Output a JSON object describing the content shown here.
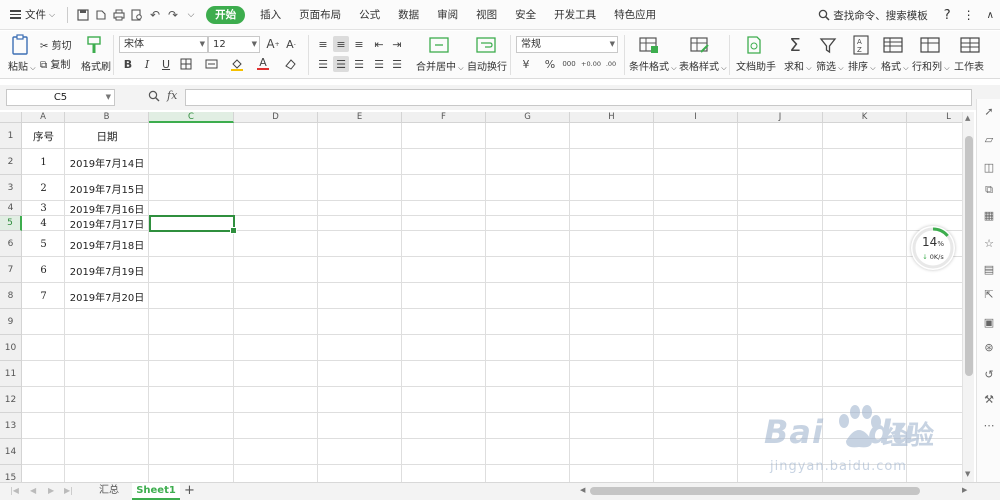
{
  "menubar": {
    "file_label": "文件",
    "tabs": [
      "开始",
      "插入",
      "页面布局",
      "公式",
      "数据",
      "审阅",
      "视图",
      "安全",
      "开发工具",
      "特色应用"
    ],
    "active_tab": "开始",
    "search_label": "查找命令、搜索模板",
    "help": "?",
    "more": "⋮",
    "collapse": "∧"
  },
  "ribbon": {
    "paste": "粘贴",
    "cut": "剪切",
    "copy": "复制",
    "format_painter": "格式刷",
    "font_name": "宋体",
    "font_size": "12",
    "bold": "B",
    "italic": "I",
    "underline": "U",
    "font_color_glyph": "A",
    "merge_center": "合并居中",
    "wrap_text": "自动换行",
    "number_format": "常规",
    "percent": "%",
    "thousands": "000",
    "inc_decimal": "+0.00",
    "dec_decimal": ".00",
    "conditional_format": "条件格式",
    "table_style": "表格样式",
    "doc_helper": "文档助手",
    "sum": "求和",
    "filter": "筛选",
    "sort": "排序",
    "format": "格式",
    "row_col": "行和列",
    "worksheet": "工作表"
  },
  "formula_bar": {
    "cell_ref": "C5",
    "fx": "fx",
    "formula": ""
  },
  "grid": {
    "columns": [
      "A",
      "B",
      "C",
      "D",
      "E",
      "F",
      "G",
      "H",
      "I",
      "J",
      "K",
      "L"
    ],
    "selected_column": "C",
    "selected_row": "5",
    "rows": [
      "1",
      "2",
      "3",
      "4",
      "5",
      "6",
      "7",
      "8",
      "9",
      "10",
      "11",
      "12",
      "13",
      "14",
      "15"
    ],
    "header_a": "序号",
    "header_b": "日期",
    "records": [
      {
        "num": "1",
        "date": "2019年7月14日"
      },
      {
        "num": "2",
        "date": "2019年7月15日"
      },
      {
        "num": "3",
        "date": "2019年7月16日"
      },
      {
        "num": "4",
        "date": "2019年7月17日"
      },
      {
        "num": "5",
        "date": "2019年7月18日"
      },
      {
        "num": "6",
        "date": "2019年7月19日"
      },
      {
        "num": "7",
        "date": "2019年7月20日"
      }
    ]
  },
  "network_widget": {
    "percent": "14",
    "percent_sign": "%",
    "speed": "0K/s",
    "progress": 0.14
  },
  "sheets": {
    "tabs": [
      "汇总",
      "Sheet1"
    ],
    "active": "Sheet1",
    "add": "+"
  },
  "watermark": {
    "brand_latin": "Bai",
    "brand_latin_2": "du",
    "brand_cn": "经验",
    "url": "jingyan.baidu.com"
  },
  "colors": {
    "accent": "#3dad4e",
    "selection": "#2f8f3e",
    "gridline": "#dedede"
  }
}
